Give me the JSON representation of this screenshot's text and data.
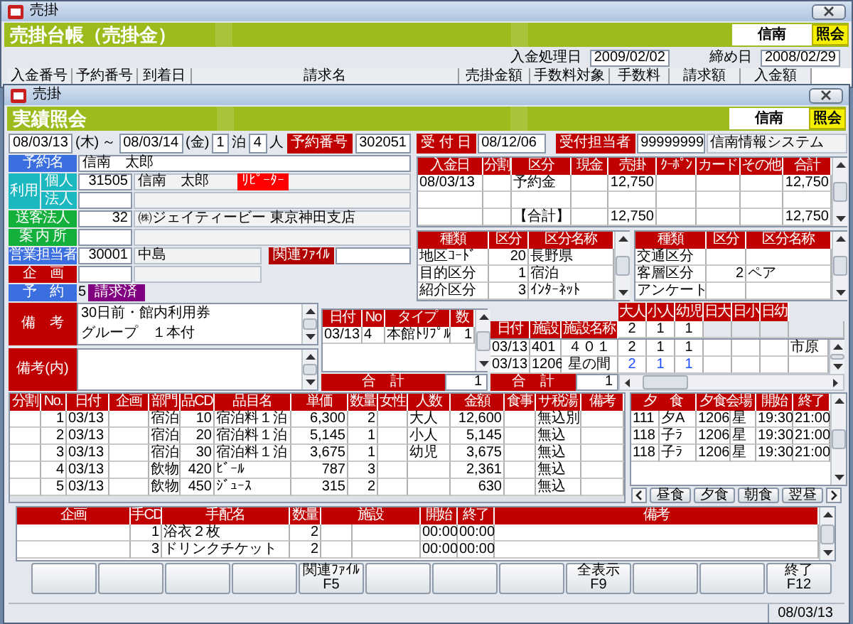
{
  "back_window": {
    "title": "売掛",
    "header": "売掛台帳（売掛金）",
    "company": "信南",
    "mode": "照会",
    "dates": [
      {
        "label": "入金処理日",
        "value": "2009/02/02"
      },
      {
        "label": "締め日",
        "value": "2008/02/29"
      }
    ],
    "columns": [
      "入金番号",
      "予約番号",
      "到着日",
      "請求名",
      "売掛金額",
      "手数料対象",
      "手数料",
      "請求額",
      "入金額"
    ]
  },
  "window": {
    "title": "売掛",
    "header": "実績照会",
    "company": "信南",
    "mode": "照会"
  },
  "stay": {
    "arrival": "08/03/13",
    "arrival_day": "(木)",
    "range_mark": "～",
    "departure": "08/03/14",
    "departure_day": "(金)",
    "nights": "1",
    "nights_unit": "泊",
    "guests": "4",
    "guests_unit": "人",
    "reservation_label": "予約番号",
    "reservation_no": "302051"
  },
  "reception": {
    "date_label": "受 付 日",
    "date": "08/12/06",
    "staff_label": "受付担当者",
    "staff_code": "99999999",
    "staff_name": "信南情報システム"
  },
  "customer": [
    {
      "kind": "name",
      "label": "予約名",
      "color": "#3b6fe0",
      "value": "信南　太郎"
    },
    {
      "kind": "usage",
      "label": "利用",
      "color": "#1bb8c0",
      "rows": [
        {
          "label": "個人",
          "code": "31505",
          "name": "信南　太郎",
          "badge": "ﾘﾋﾟｰﾀｰ"
        },
        {
          "label": "法人"
        }
      ]
    },
    {
      "kind": "code",
      "label": "送客法人",
      "color": "#13b13b",
      "code": "32",
      "name": "㈱ジェイティービー 東京神田支店"
    },
    {
      "kind": "code",
      "label": "案 内 所",
      "color": "#13b13b"
    },
    {
      "kind": "staff",
      "label": "営業担当者",
      "color": "#3b6fe0",
      "code": "30001",
      "name": "中島",
      "file_label": "関連ﾌｧｲﾙ"
    },
    {
      "kind": "plan",
      "label": "企　画",
      "color": "#c00000"
    },
    {
      "kind": "status",
      "label": "予　約",
      "color": "#3b6fe0",
      "code": "5",
      "status": "請求済"
    }
  ],
  "payments": {
    "columns": [
      "入金日",
      "分割",
      "区分",
      "現金",
      "売掛",
      "ｸｰﾎﾟﾝ",
      "カード",
      "その他",
      "合計"
    ],
    "rows": [
      {
        "date": "08/03/13",
        "type": "予約金",
        "credit": "12,750",
        "total": "12,750"
      }
    ],
    "total": {
      "type": "【合計】",
      "credit": "12,750",
      "total": "12,750"
    }
  },
  "categories": [
    {
      "columns": [
        "種類",
        "区分",
        "区分名称"
      ],
      "rows": [
        {
          "kind": "地区ｺｰﾄﾞ",
          "code": "20",
          "name": "長野県"
        },
        {
          "kind": "目的区分",
          "code": "1",
          "name": "宿泊"
        },
        {
          "kind": "紹介区分",
          "code": "3",
          "name": "ｲﾝﾀｰﾈｯﾄ"
        }
      ]
    },
    {
      "columns": [
        "種類",
        "区分",
        "区分名称"
      ],
      "rows": [
        {
          "kind": "交通区分"
        },
        {
          "kind": "客層区分",
          "code": "2",
          "name": "ペア"
        },
        {
          "kind": "アンケート"
        }
      ]
    }
  ],
  "notes": [
    {
      "label": "備　考",
      "lines": [
        "30日前・館内利用券",
        "グループ　１本付"
      ]
    },
    {
      "label": "備考(内)"
    }
  ],
  "rooms": {
    "columns": [
      "日付",
      "No",
      "タイプ",
      "数"
    ],
    "rows": [
      {
        "date": "03/13",
        "no": "4",
        "type": "本館ﾄﾘﾌﾟﾙ",
        "count": "1"
      }
    ],
    "total_label": "合　計",
    "total": "1"
  },
  "facilities": {
    "count_columns": [
      "大人",
      "小人",
      "幼児",
      "日大",
      "日小",
      "日幼"
    ],
    "columns": [
      "日付",
      "施設",
      "施設名称"
    ],
    "header_counts": {
      "adult": "2",
      "child": "1",
      "infant": "1"
    },
    "rows": [
      {
        "date": "03/13",
        "code": "401",
        "name": "４０１",
        "counts": {
          "adult": "2",
          "child": "1",
          "infant": "1"
        },
        "extra": "市原",
        "color": "#000000"
      },
      {
        "date": "03/13",
        "code": "1206",
        "name": "星の間",
        "counts": {
          "adult": "2",
          "child": "1",
          "infant": "1"
        },
        "color": "#1f4fff"
      }
    ],
    "total_label": "合　計",
    "total": "1"
  },
  "items": {
    "columns": [
      "分割",
      "No.",
      "日付",
      "企画",
      "部門",
      "品CD",
      "品目名",
      "単価",
      "数量",
      "女性",
      "人数",
      "金額",
      "食事",
      "サ税湯",
      "備考"
    ],
    "rows": [
      {
        "no": "1",
        "date": "03/13",
        "dept": "宿泊",
        "code": "10",
        "name": "宿泊料１泊",
        "price": "6,300",
        "qty": "2",
        "guest_type": "大人",
        "amount": "12,600",
        "tax": "無込別"
      },
      {
        "no": "2",
        "date": "03/13",
        "dept": "宿泊",
        "code": "20",
        "name": "宿泊料１泊",
        "price": "5,145",
        "qty": "1",
        "guest_type": "小人",
        "amount": "5,145",
        "tax": "無込"
      },
      {
        "no": "3",
        "date": "03/13",
        "dept": "宿泊",
        "code": "30",
        "name": "宿泊料１泊",
        "price": "3,675",
        "qty": "1",
        "guest_type": "幼児",
        "amount": "3,675",
        "tax": "無込"
      },
      {
        "no": "4",
        "date": "03/13",
        "dept": "飲物",
        "code": "420",
        "name": "ﾋﾞｰﾙ",
        "price": "787",
        "qty": "3",
        "amount": "2,361",
        "tax": "無込"
      },
      {
        "no": "5",
        "date": "03/13",
        "dept": "飲物",
        "code": "450",
        "name": "ｼﾞｭｰｽ",
        "price": "315",
        "qty": "2",
        "amount": "630",
        "tax": "無込"
      }
    ]
  },
  "meals": {
    "columns": [
      "夕　食",
      "夕食会場",
      "開始",
      "終了"
    ],
    "rows": [
      {
        "code": "111",
        "name": "夕A",
        "venue_code": "1206",
        "venue": "星",
        "start": "19:30",
        "end": "21:00"
      },
      {
        "code": "118",
        "name": "子ﾗ",
        "venue_code": "1206",
        "venue": "星",
        "start": "19:30",
        "end": "21:00"
      },
      {
        "code": "118",
        "name": "子ﾗ",
        "venue_code": "1206",
        "venue": "星",
        "start": "19:30",
        "end": "21:00"
      }
    ],
    "tabs": [
      "昼食",
      "夕食",
      "朝食",
      "翌昼"
    ]
  },
  "arrangements": {
    "columns": [
      "企画",
      "手CD",
      "手配名",
      "数量",
      "施設",
      "開始",
      "終了",
      "備考"
    ],
    "rows": [
      {
        "code": "1",
        "name": "浴衣２枚",
        "qty": "2",
        "start": "00:00",
        "end": "00:00"
      },
      {
        "code": "3",
        "name": "ドリンクチケット",
        "qty": "2",
        "start": "00:00",
        "end": "00:00"
      }
    ]
  },
  "function_keys": [
    {
      "kind": "blank"
    },
    {
      "kind": "blank"
    },
    {
      "kind": "blank"
    },
    {
      "kind": "blank"
    },
    {
      "kind": "key",
      "label": "関連ﾌｧｲﾙ",
      "key": "F5"
    },
    {
      "kind": "blank"
    },
    {
      "kind": "blank"
    },
    {
      "kind": "blank"
    },
    {
      "kind": "key",
      "label": "全表示",
      "key": "F9"
    },
    {
      "kind": "blank"
    },
    {
      "kind": "blank"
    },
    {
      "kind": "key",
      "label": "終了",
      "key": "F12"
    }
  ],
  "status_bar": {
    "date": "08/03/13"
  }
}
